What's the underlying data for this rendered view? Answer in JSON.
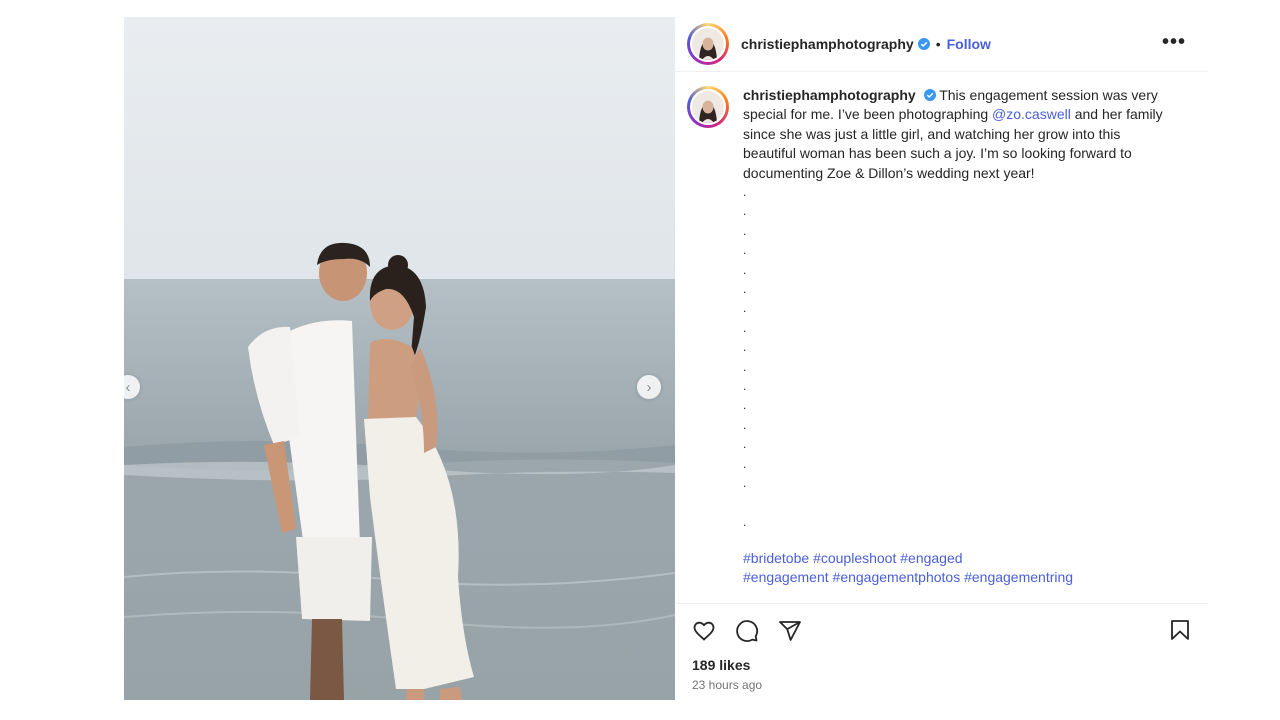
{
  "post": {
    "author": "christiephamphotography",
    "header_separator": "•",
    "follow_label": "Follow",
    "more_icon": "more-horizontal-icon",
    "caption": {
      "text_before_mention": "This engagement session was very special for me. I’ve been photographing ",
      "mention": "@zo.caswell",
      "text_after_mention": " and her family since she was just a little girl, and watching her grow into this beautiful woman has been such a joy. I’m so looking forward to documenting Zoe & Dillon’s wedding next year!"
    },
    "dot_lines": [
      ".",
      ".",
      ".",
      ".",
      ".",
      ".",
      ".",
      ".",
      ".",
      ".",
      ".",
      ".",
      ".",
      ".",
      ".",
      ".",
      "",
      "."
    ],
    "hashtags": [
      "#bridetobe",
      "#coupleshoot",
      "#engaged",
      "#engagement",
      "#engagementphotos",
      "#engagementring"
    ],
    "likes": "189 likes",
    "timestamp": "23 hours ago"
  },
  "carousel": {
    "prev_icon": "chevron-left-icon",
    "next_icon": "chevron-right-icon",
    "prev_glyph": "‹",
    "next_glyph": "›"
  },
  "actions": {
    "like_icon": "heart-icon",
    "comment_icon": "comment-icon",
    "share_icon": "paper-plane-icon",
    "save_icon": "bookmark-icon"
  },
  "colors": {
    "link": "#4a5fd9",
    "verified": "#3897f0",
    "text": "#262626",
    "muted": "#737373"
  }
}
